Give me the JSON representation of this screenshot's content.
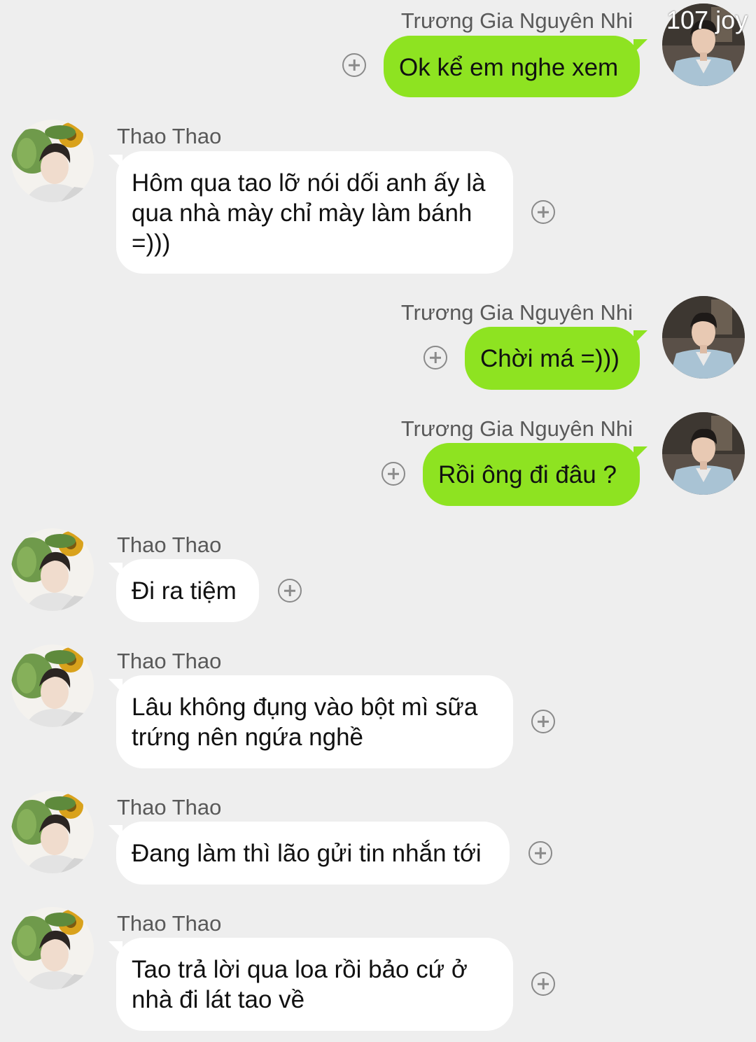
{
  "watermark": "107 joy",
  "messages": [
    {
      "sender": "Trương Gia Nguyên Nhi",
      "side": "right",
      "text": "Ok kể em nghe xem"
    },
    {
      "sender": "Thao Thao",
      "side": "left",
      "text": "Hôm qua tao lỡ nói dối anh ấy là qua nhà mày chỉ mày làm bánh =)))"
    },
    {
      "sender": "Trương Gia Nguyên Nhi",
      "side": "right",
      "text": "Chời má =)))"
    },
    {
      "sender": "Trương Gia Nguyên Nhi",
      "side": "right",
      "text": "Rồi ông đi đâu ?"
    },
    {
      "sender": "Thao Thao",
      "side": "left",
      "text": "Đi ra tiệm"
    },
    {
      "sender": "Thao Thao",
      "side": "left",
      "text": "Lâu không đụng vào bột mì sữa trứng nên ngứa nghề"
    },
    {
      "sender": "Thao Thao",
      "side": "left",
      "text": "Đang làm thì lão gửi tin nhắn tới"
    },
    {
      "sender": "Thao Thao",
      "side": "left",
      "text": "Tao trả lời qua loa rồi bảo cứ ở nhà đi lát tao về"
    }
  ],
  "colors": {
    "background": "#eeeeee",
    "outgoing_bubble": "#8ee321",
    "incoming_bubble": "#ffffff",
    "name_text": "#595959"
  },
  "icons": {
    "plus": "add-reaction-icon",
    "outgoing_avatar": "user-avatar-photo",
    "incoming_avatar": "user-avatar-photo"
  }
}
